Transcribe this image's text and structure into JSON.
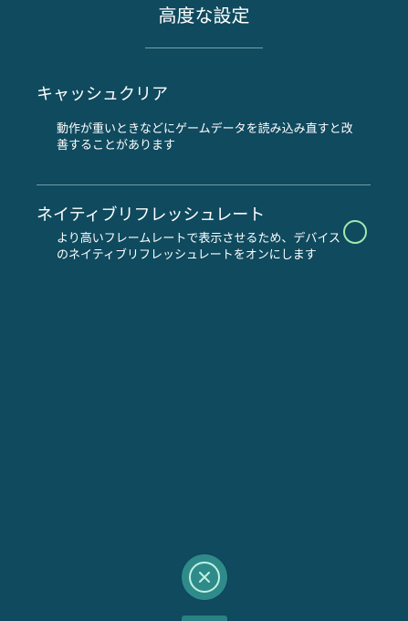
{
  "header": {
    "title": "高度な設定"
  },
  "settings": [
    {
      "title": "キャッシュクリア",
      "description": "動作が重いときなどにゲームデータを読み込み直すと改善することがあります"
    },
    {
      "title": "ネイティブリフレッシュレート",
      "description": "より高いフレームレートで表示させるため、デバイスのネイティブリフレッシュレートをオンにします",
      "toggle_state": "off"
    }
  ],
  "colors": {
    "background": "#0f4a5e",
    "toggle_ring": "#a3e7b0",
    "close_button": "#2f8b8a"
  },
  "icons": {
    "close": "close-x-icon"
  }
}
